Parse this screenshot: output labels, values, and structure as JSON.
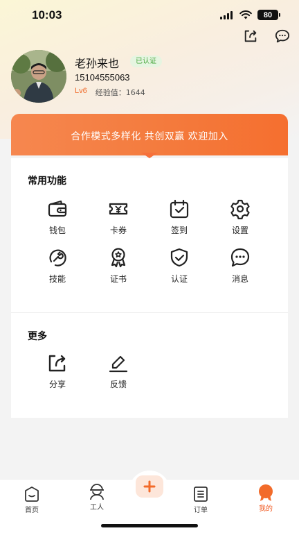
{
  "status_bar": {
    "time": "10:03",
    "battery": "80"
  },
  "profile": {
    "name": "老孙来也",
    "verified_badge": "已认证",
    "phone": "15104555063",
    "level": "Lv6",
    "experience": "经验值：1644"
  },
  "banner": {
    "text": "合作模式多样化 共创双赢 欢迎加入"
  },
  "common_functions": {
    "title": "常用功能",
    "items": [
      {
        "label": "钱包",
        "icon": "wallet-icon"
      },
      {
        "label": "卡券",
        "icon": "coupon-icon"
      },
      {
        "label": "签到",
        "icon": "calendar-check-icon"
      },
      {
        "label": "设置",
        "icon": "gear-icon"
      },
      {
        "label": "技能",
        "icon": "wrench-icon"
      },
      {
        "label": "证书",
        "icon": "certificate-icon"
      },
      {
        "label": "认证",
        "icon": "shield-check-icon"
      },
      {
        "label": "消息",
        "icon": "chat-icon"
      }
    ]
  },
  "more": {
    "title": "更多",
    "items": [
      {
        "label": "分享",
        "icon": "share-icon"
      },
      {
        "label": "反馈",
        "icon": "edit-icon"
      }
    ]
  },
  "tabbar": {
    "items": [
      {
        "label": "首页",
        "icon": "home-icon"
      },
      {
        "label": "工人",
        "icon": "worker-icon"
      },
      {
        "label": "",
        "icon": "plus-icon"
      },
      {
        "label": "订单",
        "icon": "order-icon"
      },
      {
        "label": "我的",
        "icon": "profile-icon"
      }
    ],
    "active": "我的"
  },
  "colors": {
    "accent": "#f26b2a",
    "verified_green": "#46a63b",
    "background": "#f3f3f3"
  }
}
